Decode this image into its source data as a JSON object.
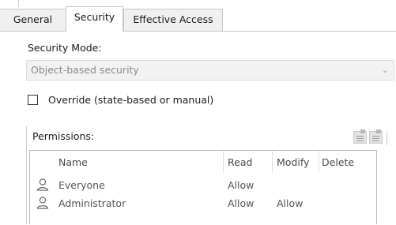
{
  "tabs": [
    {
      "label": "General",
      "active": false
    },
    {
      "label": "Security",
      "active": true
    },
    {
      "label": "Effective Access",
      "active": false
    }
  ],
  "security_mode": {
    "label": "Security Mode:",
    "value": "Object-based security",
    "disabled": true
  },
  "override": {
    "label": "Override (state-based or manual)",
    "checked": false
  },
  "permissions": {
    "label": "Permissions:",
    "columns": [
      "Name",
      "Read",
      "Modify",
      "Delete"
    ],
    "rows": [
      {
        "name": "Everyone",
        "read": "Allow",
        "modify": "",
        "delete": "",
        "icon": "user-icon"
      },
      {
        "name": "Administrator",
        "read": "Allow",
        "modify": "Allow",
        "delete": "",
        "icon": "user-icon"
      }
    ]
  },
  "icons": {
    "dropdown": "chevron-down-icon",
    "tools": [
      "add-permission-icon",
      "edit-permission-icon"
    ]
  },
  "colors": {
    "disabled_text": "#8a8a8a",
    "tab_inactive_bg": "#f0f0f0",
    "border": "#c7c7c7"
  }
}
